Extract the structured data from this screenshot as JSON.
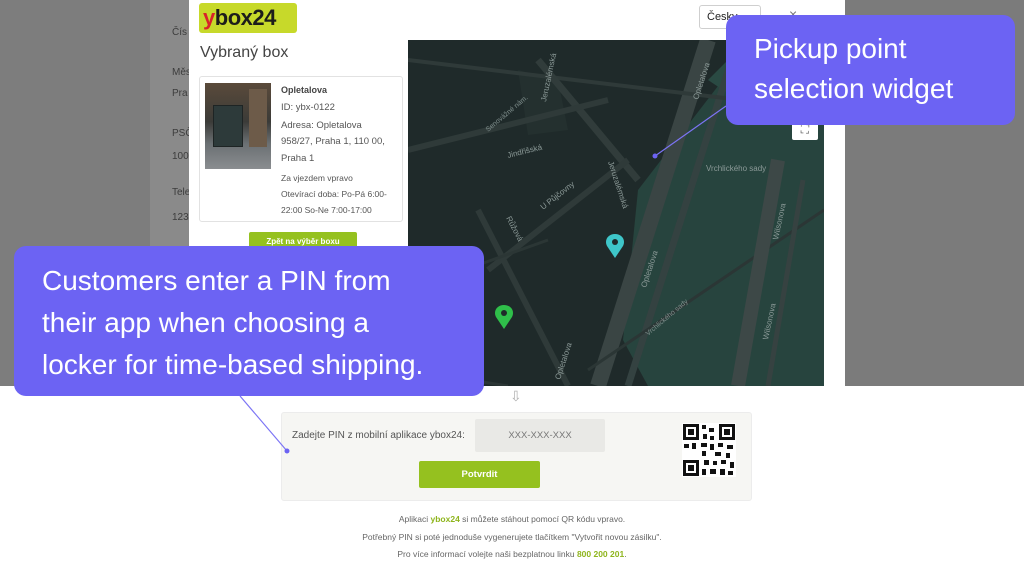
{
  "background_form": {
    "labels": [
      "Čís",
      "Měst",
      "Pra",
      "PSČ",
      "100",
      "Telef",
      "123"
    ]
  },
  "modal": {
    "logo": {
      "y": "y",
      "rest": "box24"
    },
    "language": "Česky",
    "close_icon": "×",
    "title": "Vybraný box",
    "box": {
      "name": "Opletalova",
      "id": "ID: ybx-0122",
      "address_lines": [
        "Adresa: Opletalova",
        "958/27, Praha 1, 110 00,",
        "Praha 1"
      ],
      "note": "Za vjezdem vpravo",
      "hours_lines": [
        "Otevírací doba: Po-Pá 6:00-",
        "22:00 So-Ne 7:00-17:00"
      ]
    },
    "back_button": "Zpět na výběr boxu",
    "fullscreen_icon": "⛶"
  },
  "map": {
    "streets": [
      "Opletalova",
      "Jeruzalémská",
      "Jindřišská",
      "U Půjčovny",
      "Růžová",
      "Opletalova",
      "Vrchlického sady",
      "Opletalova",
      "Wilsonova",
      "Wilsonova",
      "Opletalova",
      "Vrchlického sady",
      "Senovážné nám."
    ],
    "marker_colors": {
      "selected": "#2fbf4a",
      "other": "#3ec6c9"
    }
  },
  "callouts": {
    "top": [
      "Pickup point",
      "selection widget"
    ],
    "left": [
      "Customers enter a PIN from",
      "their app when choosing a",
      "locker for time-based shipping."
    ]
  },
  "pin_section": {
    "arrow": "⇩",
    "label": "Zadejte PIN z mobilní aplikace ybox24:",
    "placeholder": "XXX-XXX-XXX",
    "confirm_button": "Potvrdit"
  },
  "info": {
    "line1_pre": "Aplikaci ",
    "line1_brand": "ybox24",
    "line1_post": " si můžete stáhout pomocí QR kódu vpravo.",
    "line2": "Potřebný PIN si poté jednoduše vygenerujete tlačítkem \"Vytvořit novou zásilku\".",
    "line3_pre": "Pro více informací volejte naši bezplatnou linku ",
    "line3_phone": "800 200 201",
    "line3_post": "."
  },
  "colors": {
    "accent_green": "#95c11f",
    "callout_purple": "#6c63f3",
    "logo_yellow": "#c7d92a",
    "map_dark": "#1f2a2a"
  }
}
